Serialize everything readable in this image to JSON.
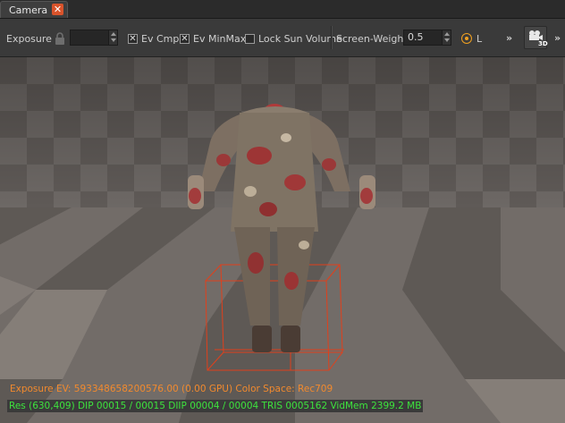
{
  "tab": {
    "title": "Camera",
    "close_glyph": "✕"
  },
  "toolbar": {
    "exposure_label": "Exposure",
    "exposure_value": "",
    "ev_cmp": {
      "label": "Ev Cmp",
      "checked": true,
      "glyph": "✕"
    },
    "ev_minmax": {
      "label": "Ev MinMax",
      "checked": true,
      "glyph": "✕"
    },
    "lock_sun_volume": {
      "label": "Lock Sun Volume",
      "checked": false,
      "glyph": ""
    },
    "screen_weight_label": "Screen-Weight",
    "screen_weight_value": "0.5",
    "radio_label": "L",
    "overflow_glyph": "»",
    "view_mode_badge": "3D",
    "icons": [
      "lock-icon",
      "camera-3d-icon",
      "chevron-double-right-icon"
    ]
  },
  "hud": {
    "line1": "Exposure EV: 593348658200576.00 (0.00 GPU)  Color Space: Rec709",
    "line2": "Res (630,409)  DIP 00015 / 00015  DIIP 00004 / 00004  TRIS 0005162  VidMem 2399.2 MB"
  },
  "colors": {
    "hud_orange": "#f28a2e",
    "hud_green": "#3de33d",
    "accent": "#f0a020",
    "close_red": "#d9532b",
    "wireframe": "#e0401c"
  }
}
